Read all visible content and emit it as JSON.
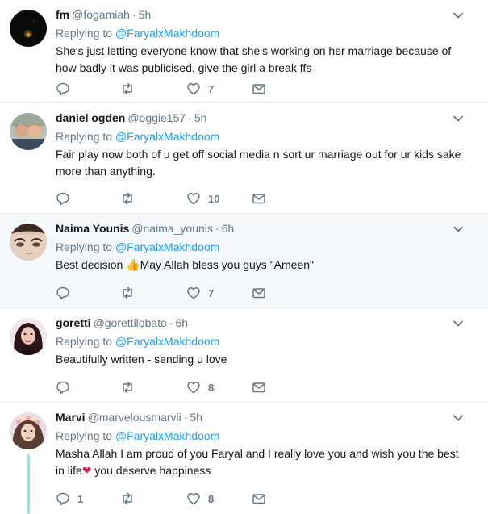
{
  "reply_prefix": "Replying to",
  "tweets": [
    {
      "name": "fm",
      "handle": "@fogamiah",
      "time": "5h",
      "reply_to": "@FaryalxMakhdoom",
      "text": "She's just letting everyone know that she's working on her marriage because of how badly it was publicised, give the girl a break ffs",
      "replies": "",
      "retweets": "",
      "likes": "7"
    },
    {
      "name": "daniel ogden",
      "handle": "@oggie157",
      "time": "5h",
      "reply_to": "@FaryalxMakhdoom",
      "text": "Fair play now both of u get off social media n sort ur marriage out for ur kids sake more than anything.",
      "replies": "",
      "retweets": "",
      "likes": "10"
    },
    {
      "name": "Naima Younis",
      "handle": "@naima_younis",
      "time": "6h",
      "reply_to": "@FaryalxMakhdoom",
      "text_before": "Best decision ",
      "text_emoji": "👍",
      "text_after": "May Allah bless you guys \"Ameen\"",
      "replies": "",
      "retweets": "",
      "likes": "7"
    },
    {
      "name": "goretti",
      "handle": "@gorettilobato",
      "time": "6h",
      "reply_to": "@FaryalxMakhdoom",
      "text": "Beautifully written - sending u love",
      "replies": "",
      "retweets": "",
      "likes": "8"
    },
    {
      "name": "Marvi",
      "handle": "@marvelousmarvii",
      "time": "5h",
      "reply_to": "@FaryalxMakhdoom",
      "text_before": "Masha Allah I am proud of you Faryal and I really love you and wish you the best in life",
      "text_emoji": "❤",
      "text_after": " you deserve happiness",
      "replies": "1",
      "retweets": "",
      "likes": "8"
    }
  ],
  "colors": {
    "accent": "#1da1f2",
    "secondary_text": "#657786",
    "highlight_bg": "#f5f8fa",
    "divider": "#e6ecf0",
    "thread_line": "#a6e0dd",
    "heart": "#e0245e"
  },
  "icons": {
    "reply": "reply-icon",
    "retweet": "retweet-icon",
    "like": "heart-icon",
    "dm": "envelope-icon",
    "more": "chevron-down-icon"
  }
}
